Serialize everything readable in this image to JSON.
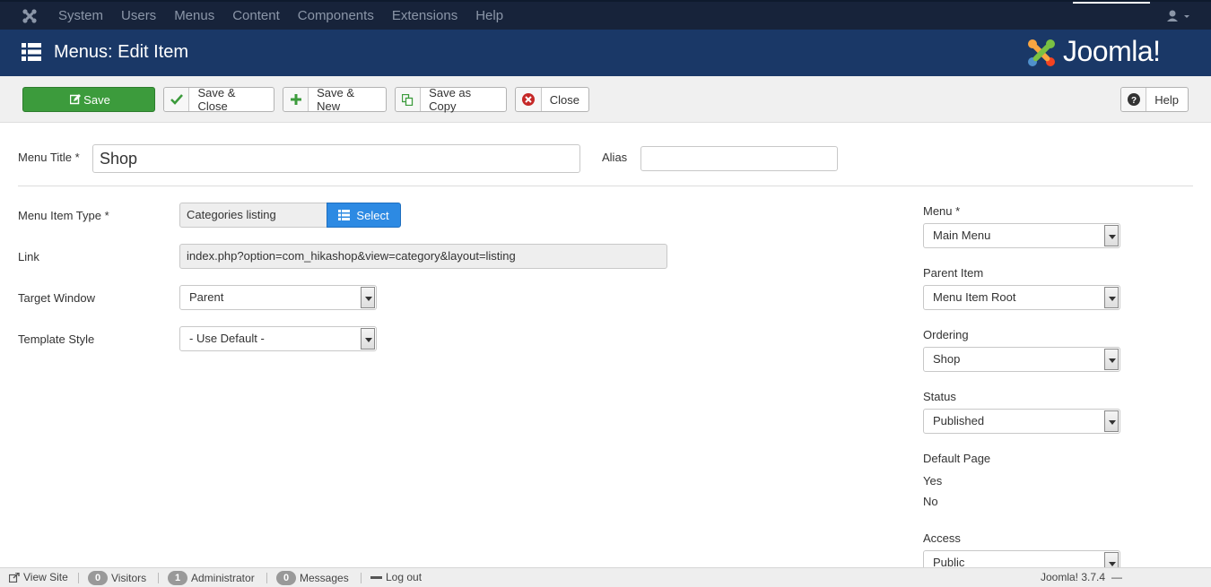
{
  "topnav": {
    "items": [
      "System",
      "Users",
      "Menus",
      "Content",
      "Components",
      "Extensions",
      "Help"
    ]
  },
  "header": {
    "title": "Menus: Edit Item",
    "brand": "Joomla!"
  },
  "toolbar": {
    "save": "Save",
    "save_close": "Save & Close",
    "save_new": "Save & New",
    "save_copy": "Save as Copy",
    "close": "Close",
    "help": "Help"
  },
  "form": {
    "menu_title_label": "Menu Title *",
    "menu_title_value": "Shop",
    "alias_label": "Alias",
    "alias_value": "",
    "item_type_label": "Menu Item Type *",
    "item_type_value": "Categories listing",
    "select_button": "Select",
    "link_label": "Link",
    "link_value": "index.php?option=com_hikashop&view=category&layout=listing",
    "target_label": "Target Window",
    "target_value": "Parent",
    "template_label": "Template Style",
    "template_value": "- Use Default -"
  },
  "sidebar": {
    "menu_label": "Menu *",
    "menu_value": "Main Menu",
    "parent_label": "Parent Item",
    "parent_value": "Menu Item Root",
    "ordering_label": "Ordering",
    "ordering_value": "Shop",
    "status_label": "Status",
    "status_value": "Published",
    "default_label": "Default Page",
    "default_yes": "Yes",
    "default_no": "No",
    "access_label": "Access",
    "access_value": "Public"
  },
  "statusbar": {
    "view_site": "View Site",
    "visitors_count": "0",
    "visitors": "Visitors",
    "admin_count": "1",
    "admin": "Administrator",
    "messages_count": "0",
    "messages": "Messages",
    "logout": "Log out",
    "version": "Joomla! 3.7.4",
    "version_suffix": "—"
  },
  "colors": {
    "topnav": "#17233a",
    "header": "#1a3867",
    "save": "#3c9b3c",
    "select_btn": "#2d8ae3"
  }
}
